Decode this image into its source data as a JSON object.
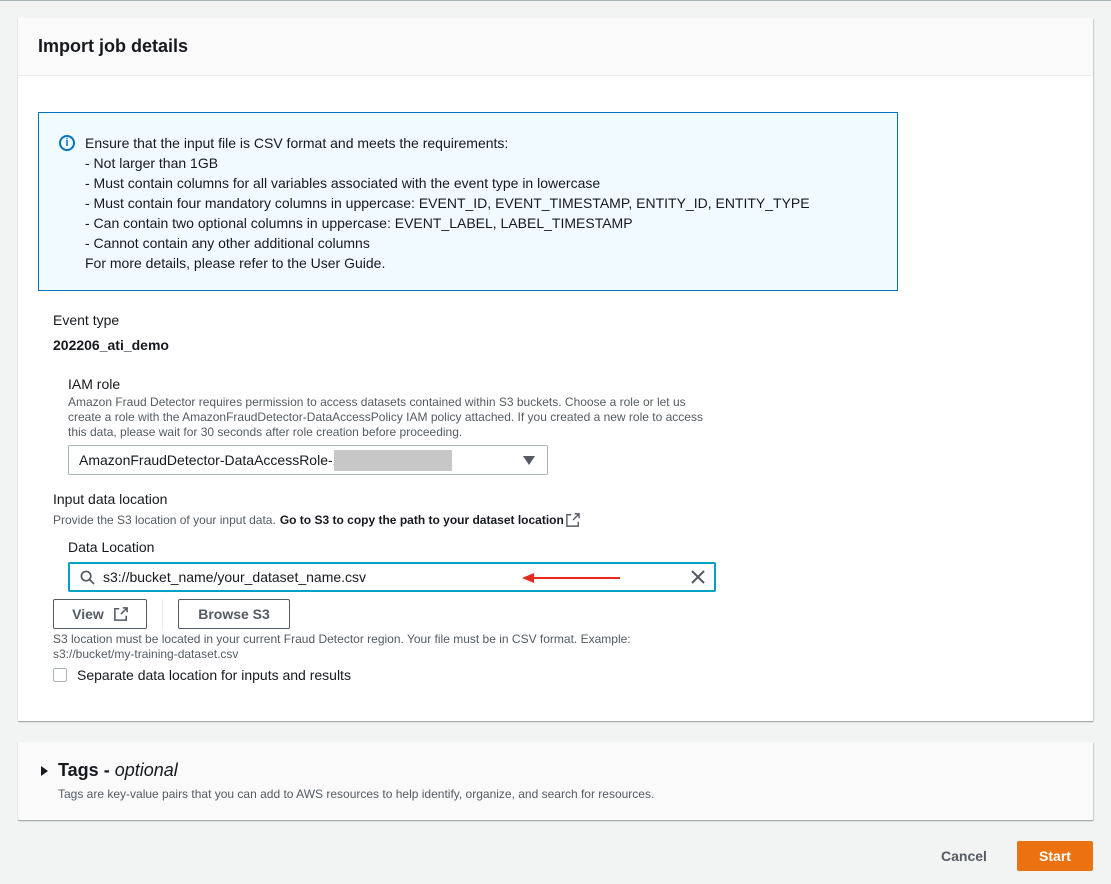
{
  "panel": {
    "title": "Import job details"
  },
  "info": {
    "lines": [
      "Ensure that the input file is CSV format and meets the requirements:",
      "- Not larger than 1GB",
      "- Must contain columns for all variables associated with the event type in lowercase",
      "- Must contain four mandatory columns in uppercase: EVENT_ID, EVENT_TIMESTAMP, ENTITY_ID, ENTITY_TYPE",
      "- Can contain two optional columns in uppercase: EVENT_LABEL, LABEL_TIMESTAMP",
      "- Cannot contain any other additional columns",
      "For more details, please refer to the User Guide."
    ]
  },
  "event_type": {
    "label": "Event type",
    "value": "202206_ati_demo"
  },
  "iam_role": {
    "label": "IAM role",
    "description": "Amazon Fraud Detector requires permission to access datasets contained within S3 buckets. Choose a role or let us create a role with the AmazonFraudDetector-DataAccessPolicy IAM policy attached. If you created a new role to access this data, please wait for 30 seconds after role creation before proceeding.",
    "selected": "AmazonFraudDetector-DataAccessRole-1"
  },
  "input_location": {
    "label": "Input data location",
    "description": "Provide the S3 location of your input data.",
    "link": "Go to S3 to copy the path to your dataset location"
  },
  "data_location": {
    "label": "Data Location",
    "value": "s3://bucket_name/your_dataset_name.csv",
    "view_label": "View",
    "browse_label": "Browse S3",
    "hint": "S3 location must be located in your current Fraud Detector region. Your file must be in CSV format. Example: s3://bucket/my-training-dataset.csv"
  },
  "separate_location": {
    "label": "Separate data location for inputs and results"
  },
  "tags": {
    "title": "Tags",
    "optional": "optional",
    "description": "Tags are key-value pairs that you can add to AWS resources to help identify, organize, and search for resources."
  },
  "footer": {
    "cancel_label": "Cancel",
    "start_label": "Start"
  },
  "colors": {
    "primary": "#ec7211",
    "focus": "#00a1c9",
    "info": "#0073bb",
    "arrow": "#e8291c"
  },
  "icons": [
    "info-icon",
    "caret-down-icon",
    "external-link-icon",
    "search-icon",
    "arrow-icon",
    "clear-icon",
    "caret-right-icon"
  ]
}
